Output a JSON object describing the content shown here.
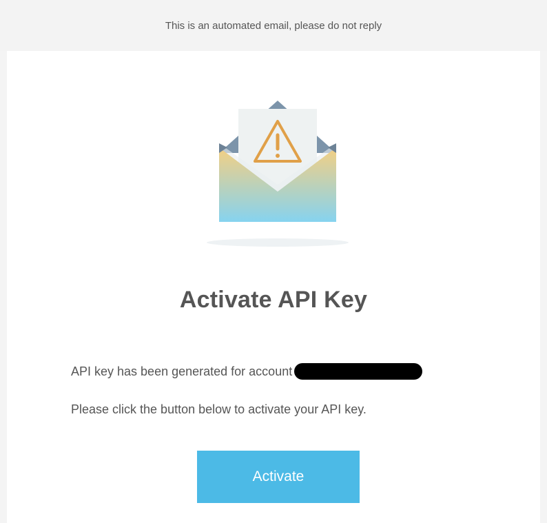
{
  "notice": {
    "text": "This is an automated email, please do not reply"
  },
  "hero": {
    "icon": "warning-envelope-icon"
  },
  "title": "Activate API Key",
  "body": {
    "line1": "API key has been generated for account",
    "line2": "Please click the button below to activate your API key."
  },
  "cta": {
    "label": "Activate"
  },
  "colors": {
    "accent": "#4cbae6",
    "text": "#555555",
    "warning": "#e0a048"
  }
}
